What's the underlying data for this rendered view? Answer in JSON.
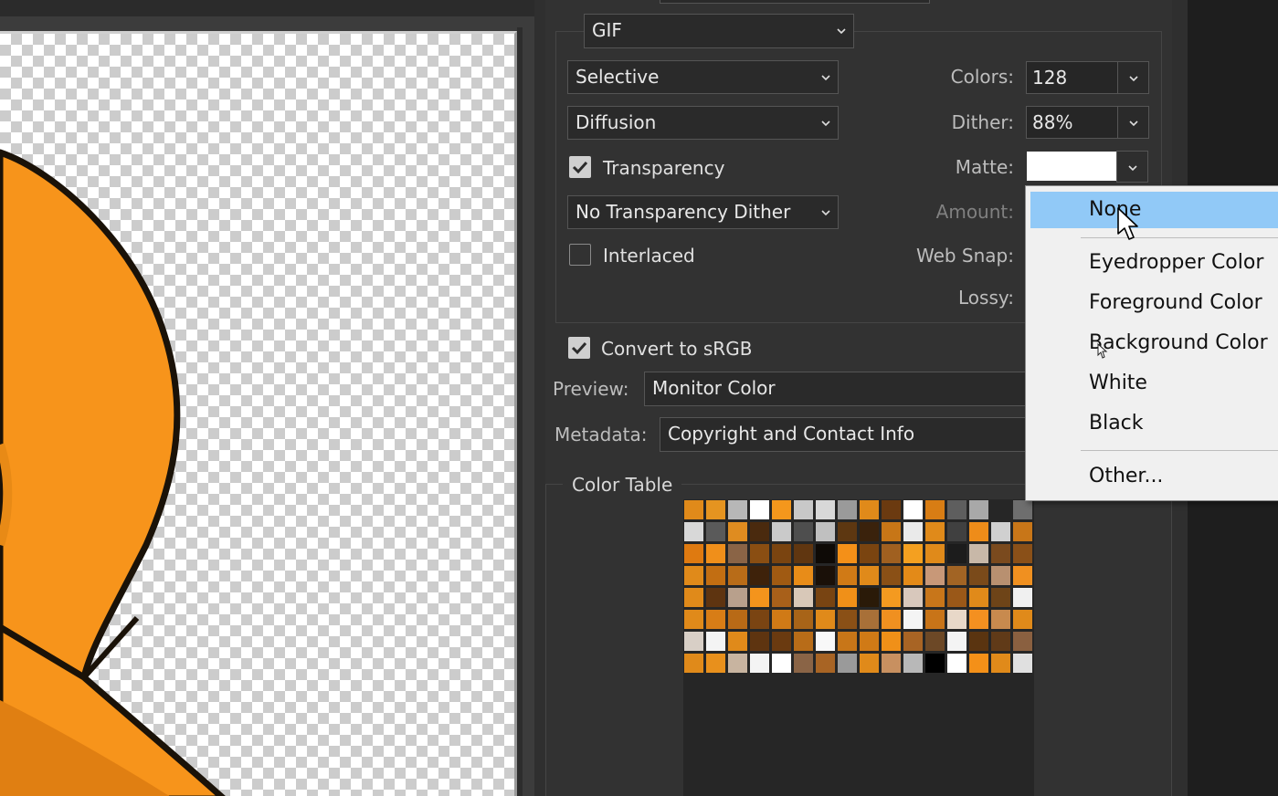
{
  "format": {
    "value": "GIF"
  },
  "reduction": {
    "value": "Selective"
  },
  "dither_algo": {
    "value": "Diffusion"
  },
  "transparency": {
    "label": "Transparency",
    "checked": true
  },
  "transparency_dither": {
    "value": "No Transparency Dither"
  },
  "interlaced": {
    "label": "Interlaced",
    "checked": false
  },
  "colors": {
    "label": "Colors:",
    "value": "128"
  },
  "dither": {
    "label": "Dither:",
    "value": "88%"
  },
  "matte": {
    "label": "Matte:",
    "swatch": "#ffffff"
  },
  "amount": {
    "label": "Amount:"
  },
  "web_snap": {
    "label": "Web Snap:"
  },
  "lossy": {
    "label": "Lossy:"
  },
  "convert_srgb": {
    "label": "Convert to sRGB",
    "checked": true
  },
  "preview": {
    "label": "Preview:",
    "value": "Monitor Color"
  },
  "metadata": {
    "label": "Metadata:",
    "value": "Copyright and Contact Info"
  },
  "color_table": {
    "title": "Color Table",
    "rows": [
      [
        "#e08a1a",
        "#e59420",
        "#b7b7b7",
        "#ffffff",
        "#f4971c",
        "#c8c8c8",
        "#d8d8d8",
        "#9a9a9a",
        "#e08a1a",
        "#6b3a10",
        "#ffffff",
        "#d87d14",
        "#5e5e5e",
        "#a8a8a8",
        "#262626",
        "#6e6e6e"
      ],
      [
        "#d8d8d8",
        "#5a5a5a",
        "#df8c20",
        "#4a2a0e",
        "#cacaca",
        "#4e4e4e",
        "#c0c0c0",
        "#5d3711",
        "#3a220c",
        "#c77617",
        "#eaeaea",
        "#e08a1a",
        "#404040",
        "#ee8c19",
        "#d0d0d0",
        "#c87618"
      ],
      [
        "#df7a10",
        "#f08f1a",
        "#8a6446",
        "#8a4e12",
        "#7a4410",
        "#603610",
        "#0e0a06",
        "#f49018",
        "#7a4410",
        "#a06020",
        "#f4a020",
        "#e08a1a",
        "#1c1c1c",
        "#c8b8a8",
        "#7a4a1e",
        "#8a5018"
      ],
      [
        "#e08a1a",
        "#c26e12",
        "#b86c18",
        "#3e220a",
        "#a05a12",
        "#e88c18",
        "#1a1008",
        "#d07a16",
        "#e08a1a",
        "#8a5016",
        "#e38a18",
        "#c89878",
        "#a26424",
        "#7a4a1a",
        "#b89070",
        "#f09020"
      ],
      [
        "#e08a1a",
        "#5e3410",
        "#b8a08c",
        "#f4941c",
        "#a8601a",
        "#d8c8b8",
        "#784412",
        "#f09018",
        "#2a1a08",
        "#f49a20",
        "#d8c8bc",
        "#c8761a",
        "#9a5818",
        "#e08a1a",
        "#6e4418",
        "#f0f0f0"
      ],
      [
        "#e08a1a",
        "#d87d16",
        "#b86a16",
        "#7a4412",
        "#d07a16",
        "#a86418",
        "#e08a1a",
        "#8a5016",
        "#a87038",
        "#f09020",
        "#f4f4f4",
        "#c87418",
        "#e8d8c8",
        "#f49020",
        "#c88a4e",
        "#e08a1a"
      ],
      [
        "#d8cfc6",
        "#f4f4f4",
        "#e08a1a",
        "#5e3410",
        "#6a3a10",
        "#b86c18",
        "#f8f8f8",
        "#c87618",
        "#d07a16",
        "#f09018",
        "#a86424",
        "#6c4826",
        "#f4f4f4",
        "#5a3410",
        "#603a18",
        "#8a6040"
      ],
      [
        "#e08a1a",
        "#e8901c",
        "#c8b4a0",
        "#f4f4f4",
        "#ffffff",
        "#8a6446",
        "#a86424",
        "#9a9a9a",
        "#e08a1a",
        "#c89060",
        "#b8b8b8",
        "#000000",
        "#ffffff",
        "#f49018",
        "#e08a1a",
        "#e0e0e0"
      ]
    ]
  },
  "matte_menu": {
    "items": [
      "None",
      "Eyedropper Color",
      "Foreground Color",
      "Background Color",
      "White",
      "Black",
      "Other..."
    ],
    "selected": "None"
  },
  "icons": [
    "chevron-down-icon",
    "checkmark-icon",
    "mouse-pointer-icon"
  ]
}
